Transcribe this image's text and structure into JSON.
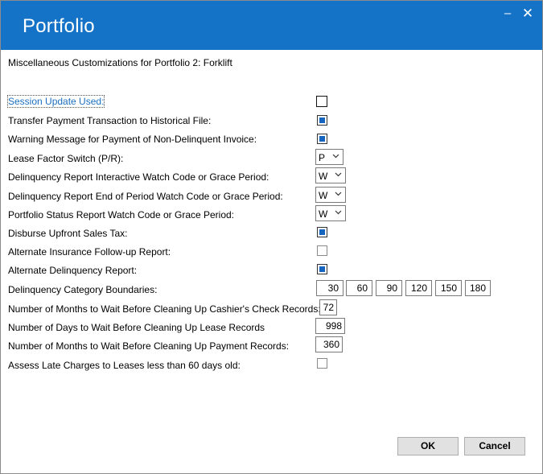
{
  "window": {
    "title": "Portfolio",
    "minimize_glyph": "–",
    "close_glyph": "✕"
  },
  "heading": "Miscellaneous Customizations  for Portfolio  2: Forklift",
  "rows": {
    "session_update": {
      "label": "Session Update Used:",
      "checked": false
    },
    "transfer_payment": {
      "label": "Transfer Payment Transaction to Historical File:",
      "checked": true
    },
    "warning_message": {
      "label": "Warning Message for Payment of Non-Delinquent Invoice:",
      "checked": true
    },
    "lease_factor": {
      "label": "Lease Factor Switch (P/R):",
      "value": "P"
    },
    "delinq_interactive": {
      "label": "Delinquency Report Interactive Watch Code or Grace Period:",
      "value": "W"
    },
    "delinq_end_period": {
      "label": "Delinquency Report End of Period Watch Code or Grace Period:",
      "value": "W"
    },
    "portfolio_status": {
      "label": "Portfolio Status Report Watch Code or Grace Period:",
      "value": "W"
    },
    "disburse_upfront": {
      "label": "Disburse Upfront Sales Tax:",
      "checked": true
    },
    "alt_insurance": {
      "label": "Alternate Insurance Follow-up Report:",
      "checked": false
    },
    "alt_delinquency": {
      "label": "Alternate Delinquency Report:",
      "checked": true
    },
    "delinq_boundaries": {
      "label": "Delinquency Category Boundaries:",
      "values": [
        "30",
        "60",
        "90",
        "120",
        "150",
        "180"
      ]
    },
    "months_cashier": {
      "label": "Number of Months to Wait Before Cleaning Up Cashier's Check Records:",
      "value": "72"
    },
    "days_lease": {
      "label": "Number of Days to Wait Before Cleaning Up   Lease Records",
      "value": "998"
    },
    "months_payment": {
      "label": "Number of Months to Wait Before Cleaning Up Payment Records:",
      "value": "360"
    },
    "late_charges": {
      "label": "Assess Late Charges to Leases less than 60 days old:",
      "checked": false
    }
  },
  "buttons": {
    "ok": "OK",
    "cancel": "Cancel"
  },
  "colors": {
    "titlebar": "#1473c6",
    "check_fill": "#1565c0",
    "link_label": "#1a6fc0"
  }
}
